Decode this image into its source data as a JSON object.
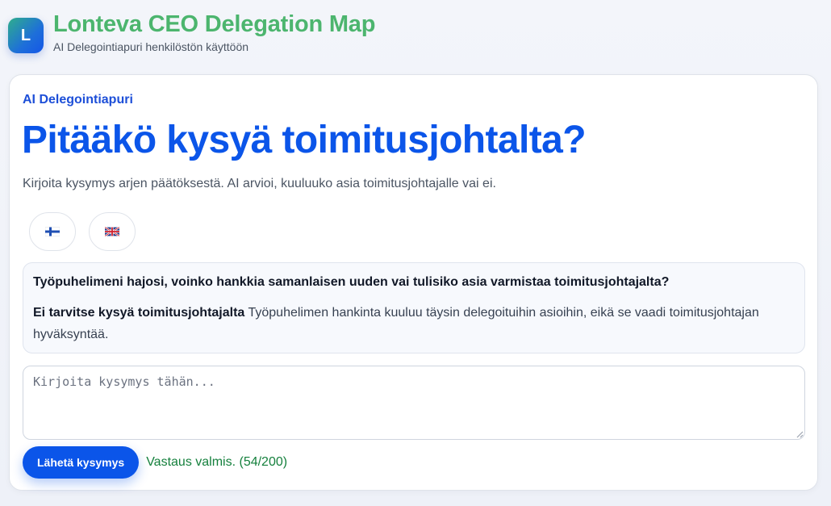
{
  "header": {
    "logo_letter": "L",
    "title": "Lonteva CEO Delegation Map",
    "subtitle": "AI Delegointiapuri henkilöstön käyttöön"
  },
  "card": {
    "eyebrow": "AI Delegointiapuri",
    "headline": "Pitääkö kysyä toimitusjohtalta?",
    "lead": "Kirjoita kysymys arjen päätöksestä. AI arvioi, kuuluuko asia toimitusjohtajalle vai ei."
  },
  "languages": [
    {
      "code": "fi",
      "flag_icon": "finland-flag-icon"
    },
    {
      "code": "en",
      "flag_icon": "uk-flag-icon"
    }
  ],
  "conversation": {
    "question": "Työpuhelimeni hajosi, voinko hankkia samanlaisen uuden vai tulisiko asia varmistaa toimitusjohtajalta?",
    "verdict": "Ei tarvitse kysyä toimitusjohtajalta",
    "explanation": " Työpuhelimen hankinta kuuluu täysin delegoituihin asioihin, eikä se vaadi toimitusjohtajan hyväksyntää."
  },
  "input": {
    "value": "",
    "placeholder": "Kirjoita kysymys tähän..."
  },
  "footer": {
    "send_label": "Lähetä kysymys",
    "status": "Vastaus valmis. (54/200)"
  },
  "colors": {
    "brand_green": "#4cb56e",
    "primary_blue": "#0b55e9",
    "status_green": "#15803d"
  }
}
